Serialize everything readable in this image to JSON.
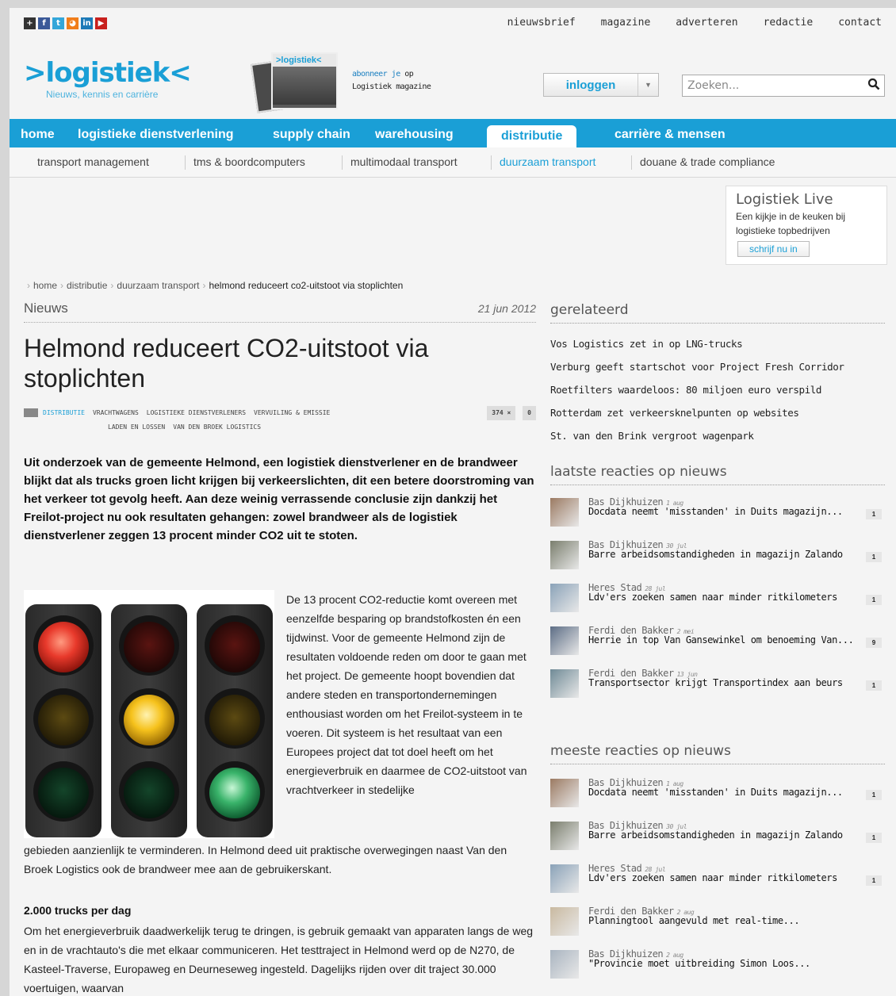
{
  "social": [
    {
      "icon": "plus-icon",
      "glyph": "+",
      "color": "#333333"
    },
    {
      "icon": "facebook-icon",
      "glyph": "f",
      "color": "#3b5998"
    },
    {
      "icon": "twitter-icon",
      "glyph": "t",
      "color": "#33a6d9"
    },
    {
      "icon": "rss-icon",
      "glyph": "◕",
      "color": "#f07d1a"
    },
    {
      "icon": "linkedin-icon",
      "glyph": "in",
      "color": "#1d7ab7"
    },
    {
      "icon": "youtube-icon",
      "glyph": "▶",
      "color": "#c8201d"
    }
  ],
  "toplinks": [
    "nieuwsbrief",
    "magazine",
    "adverteren",
    "redactie",
    "contact"
  ],
  "logo": {
    "mark": ">logistiek<",
    "tagline": "Nieuws, kennis en carrière"
  },
  "magazine": {
    "cover_title": ">logistiek<",
    "subscribe_link": "abonneer je",
    "subscribe_rest": " op",
    "subscribe_line2": "Logistiek magazine"
  },
  "login": {
    "label": "inloggen"
  },
  "search": {
    "placeholder": "Zoeken..."
  },
  "mainnav": [
    "home",
    "logistieke dienstverlening",
    "supply chain",
    "warehousing",
    "distributie",
    "carrière & mensen"
  ],
  "mainnav_active": "distributie",
  "subnav": [
    "transport management",
    "tms & boordcomputers",
    "multimodaal transport",
    "duurzaam transport",
    "douane & trade compliance"
  ],
  "subnav_active": "duurzaam transport",
  "live": {
    "title": "Logistiek Live",
    "desc": "Een kijkje in de keuken bij logistieke topbedrijven",
    "button": "schrijf nu in"
  },
  "breadcrumb": [
    "home",
    "distributie",
    "duurzaam transport",
    "helmond reduceert co2-uitstoot via stoplichten"
  ],
  "article": {
    "category": "Nieuws",
    "date": "21 jun 2012",
    "title": "Helmond reduceert CO2-uitstoot via stoplichten",
    "tags_line1": [
      "DISTRIBUTIE",
      "VRACHTWAGENS",
      "LOGISTIEKE DIENSTVERLENERS",
      "VERVUILING & EMISSIE"
    ],
    "tags_line2": [
      "LADEN EN LOSSEN",
      "VAN DEN BROEK LOGISTICS"
    ],
    "views": "374 ×",
    "comments": "0",
    "lead": "Uit onderzoek van de gemeente Helmond, een logistiek dienstverlener en de brandweer blijkt dat als trucks groen licht krijgen bij verkeerslichten, dit een betere doorstroming van het verkeer tot gevolg heeft. Aan deze weinig verrassende conclusie zijn dankzij het Freilot-project nu ook resultaten gehangen: zowel brandweer als de logistiek dienstverlener zeggen 13 procent minder CO2 uit te stoten.",
    "body1": "De 13 procent CO2-reductie komt overeen met eenzelfde besparing op brandstofkosten én een tijdwinst. Voor de gemeente Helmond zijn de resultaten voldoende reden om door te gaan met het project. De gemeente hoopt bovendien dat andere steden en transportondernemingen enthousiast worden om het Freilot-systeem in te voeren. Dit systeem is het resultaat van een Europees project dat tot doel heeft om het energieverbruik en daarmee de CO2-uitstoot van vrachtverkeer in stedelijke",
    "body2": "gebieden aanzienlijk te verminderen. In Helmond deed uit praktische overwegingen naast Van den Broek Logistics ook de brandweer mee aan de gebruikerskant.",
    "subheading": "2.000 trucks per dag",
    "body3": "Om het energieverbruik daadwerkelijk terug te dringen, is gebruik gemaakt van apparaten langs de weg en in de vrachtauto's die met elkaar communiceren. Het testtraject in Helmond werd op de N270, de Kasteel-Traverse, Europaweg en Deurneseweg ingesteld. Dagelijks rijden over dit traject 30.000 voertuigen, waarvan"
  },
  "related": {
    "heading": "gerelateerd",
    "items": [
      "Vos Logistics zet in op LNG-trucks",
      "Verburg geeft startschot voor Project Fresh Corridor",
      "Roetfilters waardeloos: 80 miljoen euro verspild",
      "Rotterdam zet verkeersknelpunten op websites",
      "St. van den Brink vergroot wagenpark"
    ]
  },
  "latest": {
    "heading": "laatste reacties op nieuws",
    "items": [
      {
        "author": "Bas Dijkhuizen",
        "when": "1 aug",
        "text": "Docdata neemt 'misstanden' in Duits magazijn...",
        "count": "1",
        "avatar": "#9b7a62"
      },
      {
        "author": "Bas Dijkhuizen",
        "when": "30 jul",
        "text": "Barre arbeidsomstandigheden in magazijn Zalando",
        "count": "1",
        "avatar": "#7a7e6d"
      },
      {
        "author": "Heres Stad",
        "when": "28 jul",
        "text": "Ldv'ers zoeken samen naar minder ritkilometers",
        "count": "1",
        "avatar": "#8aa2b8"
      },
      {
        "author": "Ferdi den Bakker",
        "when": "2 mei",
        "text": "Herrie in top Van Gansewinkel om benoeming Van...",
        "count": "9",
        "avatar": "#5c6d85"
      },
      {
        "author": "Ferdi den Bakker",
        "when": "13 jun",
        "text": "Transportsector krijgt Transportindex aan beurs",
        "count": "1",
        "avatar": "#6f8a96"
      }
    ]
  },
  "most": {
    "heading": "meeste reacties op nieuws",
    "items": [
      {
        "author": "Bas Dijkhuizen",
        "when": "1 aug",
        "text": "Docdata neemt 'misstanden' in Duits magazijn...",
        "count": "1",
        "avatar": "#9b7a62"
      },
      {
        "author": "Bas Dijkhuizen",
        "when": "30 jul",
        "text": "Barre arbeidsomstandigheden in magazijn Zalando",
        "count": "1",
        "avatar": "#7a7e6d"
      },
      {
        "author": "Heres Stad",
        "when": "28 jul",
        "text": "Ldv'ers zoeken samen naar minder ritkilometers",
        "count": "1",
        "avatar": "#8aa2b8"
      },
      {
        "author": "Ferdi den Bakker",
        "when": "2 aug",
        "text": "Planningtool aangevuld met real-time...",
        "count": "",
        "avatar": "#c9b9a0"
      },
      {
        "author": "Bas Dijkhuizen",
        "when": "2 aug",
        "text": "\"Provincie moet uitbreiding Simon Loos...",
        "count": "",
        "avatar": "#a9b4c0"
      }
    ]
  },
  "colors": {
    "brand": "#1a9fd6",
    "red_light": "#e8392b",
    "yellow_light": "#f6c21c",
    "green_light": "#39b36a"
  }
}
